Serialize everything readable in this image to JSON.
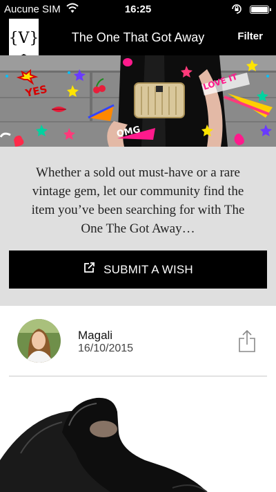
{
  "status_bar": {
    "carrier": "Aucune SIM",
    "time": "16:25"
  },
  "nav": {
    "logo_text": "{V}",
    "title": "The One That Got Away",
    "filter_label": "Filter"
  },
  "banner": {
    "stickers": [
      "YES",
      "LOVE IT",
      "OMG"
    ]
  },
  "intro": {
    "text": "Whether a sold out must-have or a rare vintage gem, let our community find the item you’ve been searching for with The One The Got Away…",
    "button_label": "SUBMIT A WISH"
  },
  "post": {
    "username": "Magali",
    "date": "16/10/2015"
  },
  "icons": [
    "wifi-icon",
    "rotation-lock-icon",
    "battery-icon",
    "logo-icon",
    "edit-icon",
    "share-icon"
  ]
}
